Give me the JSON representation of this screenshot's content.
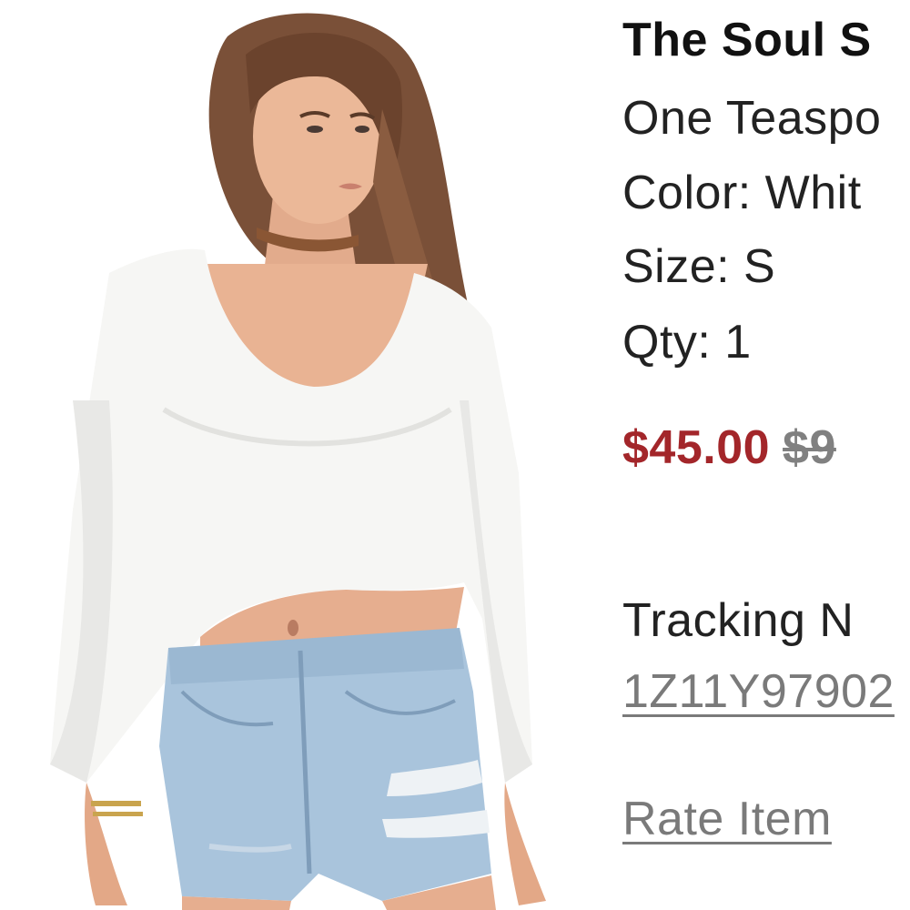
{
  "product": {
    "name": "The Soul S",
    "brand": "One Teaspo",
    "color_line": "Color: Whit",
    "size_line": "Size: S",
    "qty_line": "Qty: 1"
  },
  "pricing": {
    "sale_price": "$45.00",
    "original_price": "$9"
  },
  "shipment": {
    "tracking_label": "Tracking N",
    "tracking_number": "1Z11Y97902"
  },
  "actions": {
    "rate_item_label": "Rate Item"
  },
  "colors": {
    "sale_price": "#a3262a",
    "original_price": "#808080",
    "link": "#7a7a7a",
    "text": "#222222"
  }
}
